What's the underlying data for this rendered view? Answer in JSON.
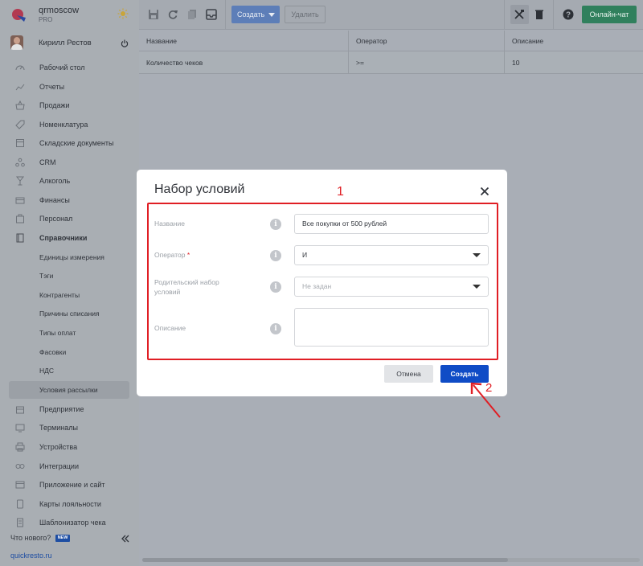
{
  "brand": {
    "name": "qrmoscow",
    "plan": "PRO"
  },
  "user": {
    "name": "Кирилл Рестов"
  },
  "sidebar": {
    "items": [
      {
        "label": "Рабочий стол",
        "icon": "dashboard-icon"
      },
      {
        "label": "Отчеты",
        "icon": "reports-icon"
      },
      {
        "label": "Продажи",
        "icon": "basket-icon"
      },
      {
        "label": "Номенклатура",
        "icon": "tag-icon"
      },
      {
        "label": "Складские документы",
        "icon": "documents-icon"
      },
      {
        "label": "CRM",
        "icon": "crm-icon"
      },
      {
        "label": "Алкоголь",
        "icon": "glass-icon"
      },
      {
        "label": "Финансы",
        "icon": "wallet-icon"
      },
      {
        "label": "Персонал",
        "icon": "staff-icon"
      },
      {
        "label": "Справочники",
        "icon": "book-icon"
      },
      {
        "label": "Единицы измерения"
      },
      {
        "label": "Тэги"
      },
      {
        "label": "Контрагенты"
      },
      {
        "label": "Причины списания"
      },
      {
        "label": "Типы оплат"
      },
      {
        "label": "Фасовки"
      },
      {
        "label": "НДС"
      },
      {
        "label": "Условия рассылки"
      },
      {
        "label": "Предприятие",
        "icon": "enterprise-icon"
      },
      {
        "label": "Терминалы",
        "icon": "terminal-icon"
      },
      {
        "label": "Устройства",
        "icon": "printer-icon"
      },
      {
        "label": "Интеграции",
        "icon": "integration-icon"
      },
      {
        "label": "Приложение и сайт",
        "icon": "app-icon"
      },
      {
        "label": "Карты лояльности",
        "icon": "card-icon"
      },
      {
        "label": "Шаблонизатор чека",
        "icon": "receipt-icon"
      }
    ],
    "whats_new": "Что нового?",
    "new_badge": "NEW",
    "footer_link": "quickresto.ru"
  },
  "toolbar": {
    "create_label": "Создать",
    "delete_label": "Удалить",
    "chat_label": "Онлайн-чат"
  },
  "table": {
    "columns": [
      "Название",
      "Оператор",
      "Описание"
    ],
    "rows": [
      [
        "Количество чеков",
        ">=",
        "10"
      ]
    ]
  },
  "modal": {
    "title": "Набор условий",
    "fields": {
      "name_label": "Название",
      "name_value": "Все покупки от 500 рублей",
      "operator_label": "Оператор",
      "operator_required": "*",
      "operator_value": "И",
      "parent_label_line1": "Родительский набор",
      "parent_label_line2": "условий",
      "parent_placeholder": "Не задан",
      "description_label": "Описание"
    },
    "cancel_label": "Отмена",
    "create_label": "Создать"
  },
  "annotations": {
    "box_number": "1",
    "arrow_number": "2",
    "color": "#e01e24"
  },
  "colors": {
    "primary": "#0f4cc6",
    "chat": "#30805d",
    "overlay": "#a9aeb6"
  }
}
